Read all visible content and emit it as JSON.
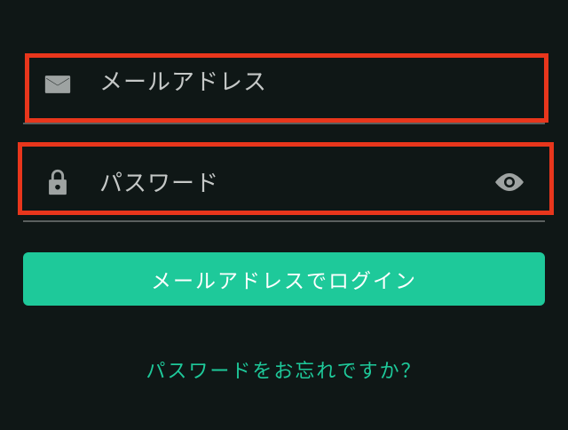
{
  "email_field": {
    "placeholder": "メールアドレス",
    "icon": "mail-icon"
  },
  "password_field": {
    "placeholder": "パスワード",
    "icon": "lock-icon",
    "toggle_icon": "eye-icon"
  },
  "login_button": {
    "label": "メールアドレスでログイン"
  },
  "forgot_link": {
    "label": "パスワードをお忘れですか？"
  },
  "colors": {
    "background": "#0f1716",
    "accent": "#1ec99a",
    "highlight": "#e8361c",
    "placeholder": "#c5c8c7",
    "icon": "#9ea3a2"
  }
}
